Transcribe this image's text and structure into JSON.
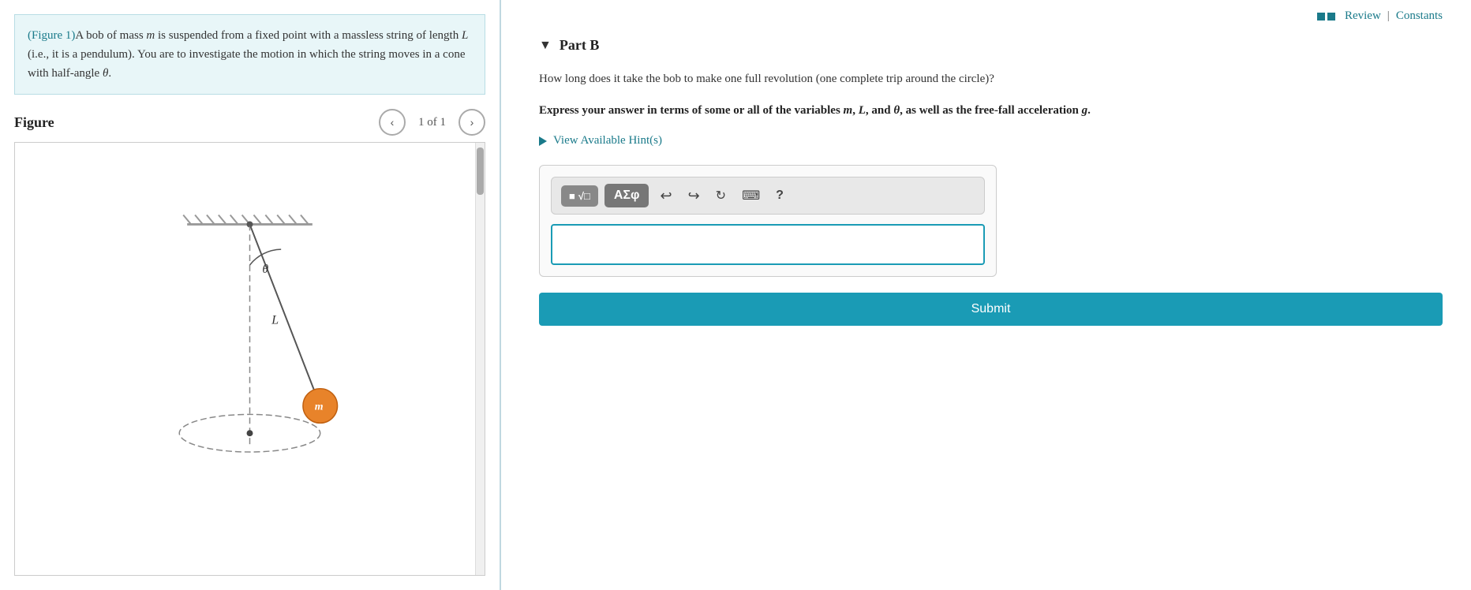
{
  "left": {
    "problem_text_prefix": "(Figure 1)",
    "problem_text": "A bob of mass ",
    "problem_m": "m",
    "problem_mid": " is suspended from a fixed point with a massless string of length ",
    "problem_L": "L",
    "problem_end": " (i.e., it is a pendulum). You are to investigate the motion in which the string moves in a cone with half-angle ",
    "problem_theta": "θ",
    "problem_period": ".",
    "figure_title": "Figure",
    "page_indicator": "1 of 1"
  },
  "right": {
    "review_label": "Review",
    "constants_label": "Constants",
    "part_title": "Part B",
    "question": "How long does it take the bob to make one full revolution (one complete trip around the circle)?",
    "instructions_prefix": "Express your answer in terms of some or all of the variables ",
    "instructions_vars": "m, L, and θ,",
    "instructions_suffix": " as well as the free-fall acceleration ",
    "instructions_g": "g",
    "instructions_end": ".",
    "hint_label": "View Available Hint(s)",
    "toolbar": {
      "formula_btn": "√□",
      "greek_btn": "ΑΣφ",
      "undo_label": "undo",
      "redo_label": "redo",
      "reset_label": "reset",
      "keyboard_label": "keyboard",
      "help_label": "?"
    },
    "submit_label": "Submit"
  }
}
